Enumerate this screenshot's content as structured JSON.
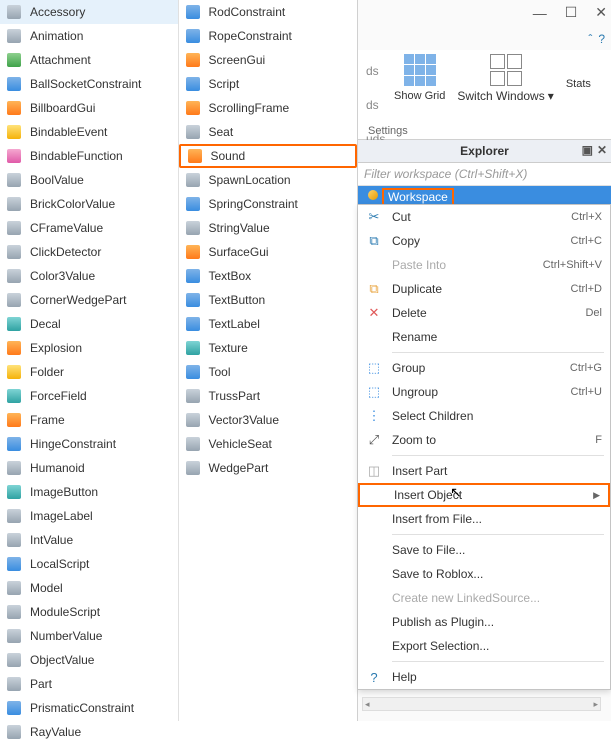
{
  "insert_menu": {
    "col1": [
      {
        "label": "Accessory",
        "icon": "accessory-icon",
        "cls": "ic-gray"
      },
      {
        "label": "Animation",
        "icon": "animation-icon",
        "cls": "ic-gray"
      },
      {
        "label": "Attachment",
        "icon": "attachment-icon",
        "cls": "ic-green"
      },
      {
        "label": "BallSocketConstraint",
        "icon": "ballsocket-icon",
        "cls": "ic-blue"
      },
      {
        "label": "BillboardGui",
        "icon": "billboardgui-icon",
        "cls": "ic-orange"
      },
      {
        "label": "BindableEvent",
        "icon": "bindableevent-icon",
        "cls": "ic-yellow"
      },
      {
        "label": "BindableFunction",
        "icon": "bindablefunction-icon",
        "cls": "ic-pink"
      },
      {
        "label": "BoolValue",
        "icon": "boolvalue-icon",
        "cls": "ic-gray"
      },
      {
        "label": "BrickColorValue",
        "icon": "brickcolorvalue-icon",
        "cls": "ic-gray"
      },
      {
        "label": "CFrameValue",
        "icon": "cframevalue-icon",
        "cls": "ic-gray"
      },
      {
        "label": "ClickDetector",
        "icon": "clickdetector-icon",
        "cls": "ic-gray"
      },
      {
        "label": "Color3Value",
        "icon": "color3value-icon",
        "cls": "ic-gray"
      },
      {
        "label": "CornerWedgePart",
        "icon": "cornerwedge-icon",
        "cls": "ic-gray"
      },
      {
        "label": "Decal",
        "icon": "decal-icon",
        "cls": "ic-teal"
      },
      {
        "label": "Explosion",
        "icon": "explosion-icon",
        "cls": "ic-orange"
      },
      {
        "label": "Folder",
        "icon": "folder-icon",
        "cls": "ic-yellow"
      },
      {
        "label": "ForceField",
        "icon": "forcefield-icon",
        "cls": "ic-teal"
      },
      {
        "label": "Frame",
        "icon": "frame-icon",
        "cls": "ic-orange"
      },
      {
        "label": "HingeConstraint",
        "icon": "hinge-icon",
        "cls": "ic-blue"
      },
      {
        "label": "Humanoid",
        "icon": "humanoid-icon",
        "cls": "ic-gray"
      },
      {
        "label": "ImageButton",
        "icon": "imagebutton-icon",
        "cls": "ic-teal"
      },
      {
        "label": "ImageLabel",
        "icon": "imagelabel-icon",
        "cls": "ic-gray"
      },
      {
        "label": "IntValue",
        "icon": "intvalue-icon",
        "cls": "ic-gray"
      },
      {
        "label": "LocalScript",
        "icon": "localscript-icon",
        "cls": "ic-blue"
      },
      {
        "label": "Model",
        "icon": "model-icon",
        "cls": "ic-gray"
      },
      {
        "label": "ModuleScript",
        "icon": "modulescript-icon",
        "cls": "ic-gray"
      },
      {
        "label": "NumberValue",
        "icon": "numbervalue-icon",
        "cls": "ic-gray"
      },
      {
        "label": "ObjectValue",
        "icon": "objectvalue-icon",
        "cls": "ic-gray"
      },
      {
        "label": "Part",
        "icon": "part-icon",
        "cls": "ic-gray"
      },
      {
        "label": "PrismaticConstraint",
        "icon": "prismatic-icon",
        "cls": "ic-blue"
      },
      {
        "label": "RayValue",
        "icon": "rayvalue-icon",
        "cls": "ic-gray"
      }
    ],
    "col2": [
      {
        "label": "RodConstraint",
        "icon": "rod-icon",
        "cls": "ic-blue"
      },
      {
        "label": "RopeConstraint",
        "icon": "rope-icon",
        "cls": "ic-blue"
      },
      {
        "label": "ScreenGui",
        "icon": "screengui-icon",
        "cls": "ic-orange"
      },
      {
        "label": "Script",
        "icon": "script-icon",
        "cls": "ic-blue"
      },
      {
        "label": "ScrollingFrame",
        "icon": "scrollingframe-icon",
        "cls": "ic-orange"
      },
      {
        "label": "Seat",
        "icon": "seat-icon",
        "cls": "ic-gray"
      },
      {
        "label": "Sound",
        "icon": "sound-icon",
        "cls": "ic-orange",
        "highlight": true
      },
      {
        "label": "SpawnLocation",
        "icon": "spawnlocation-icon",
        "cls": "ic-gray"
      },
      {
        "label": "SpringConstraint",
        "icon": "spring-icon",
        "cls": "ic-blue"
      },
      {
        "label": "StringValue",
        "icon": "stringvalue-icon",
        "cls": "ic-gray"
      },
      {
        "label": "SurfaceGui",
        "icon": "surfacegui-icon",
        "cls": "ic-orange"
      },
      {
        "label": "TextBox",
        "icon": "textbox-icon",
        "cls": "ic-blue"
      },
      {
        "label": "TextButton",
        "icon": "textbutton-icon",
        "cls": "ic-blue"
      },
      {
        "label": "TextLabel",
        "icon": "textlabel-icon",
        "cls": "ic-blue"
      },
      {
        "label": "Texture",
        "icon": "texture-icon",
        "cls": "ic-teal"
      },
      {
        "label": "Tool",
        "icon": "tool-icon",
        "cls": "ic-blue"
      },
      {
        "label": "TrussPart",
        "icon": "trusspart-icon",
        "cls": "ic-gray"
      },
      {
        "label": "Vector3Value",
        "icon": "vector3value-icon",
        "cls": "ic-gray"
      },
      {
        "label": "VehicleSeat",
        "icon": "vehicleseat-icon",
        "cls": "ic-gray"
      },
      {
        "label": "WedgePart",
        "icon": "wedgepart-icon",
        "cls": "ic-gray"
      }
    ]
  },
  "ribbon": {
    "truncated_labels": [
      "ds",
      "ds",
      "uds"
    ],
    "show_grid": "Show\nGrid",
    "switch_windows": "Switch\nWindows",
    "stats": "Stats",
    "settings": "Settings"
  },
  "explorer": {
    "title": "Explorer",
    "filter_placeholder": "Filter workspace (Ctrl+Shift+X)",
    "selected_node": "Workspace"
  },
  "context_menu": [
    {
      "type": "item",
      "label": "Cut",
      "shortcut": "Ctrl+X",
      "icon": "cut-icon",
      "glyph": "✂",
      "color": "#2a7ab0"
    },
    {
      "type": "item",
      "label": "Copy",
      "shortcut": "Ctrl+C",
      "icon": "copy-icon",
      "glyph": "⧉",
      "color": "#2a7ab0"
    },
    {
      "type": "item",
      "label": "Paste Into",
      "shortcut": "Ctrl+Shift+V",
      "icon": "paste-icon",
      "glyph": "",
      "disabled": true
    },
    {
      "type": "item",
      "label": "Duplicate",
      "shortcut": "Ctrl+D",
      "icon": "duplicate-icon",
      "glyph": "⧉",
      "color": "#e8a33d"
    },
    {
      "type": "item",
      "label": "Delete",
      "shortcut": "Del",
      "icon": "delete-icon",
      "glyph": "✕",
      "color": "#e05a5a"
    },
    {
      "type": "item",
      "label": "Rename",
      "icon": "rename-icon",
      "glyph": ""
    },
    {
      "type": "sep"
    },
    {
      "type": "item",
      "label": "Group",
      "shortcut": "Ctrl+G",
      "icon": "group-icon",
      "glyph": "⬚",
      "color": "#3a8de0"
    },
    {
      "type": "item",
      "label": "Ungroup",
      "shortcut": "Ctrl+U",
      "icon": "ungroup-icon",
      "glyph": "⬚",
      "color": "#3a8de0"
    },
    {
      "type": "item",
      "label": "Select Children",
      "icon": "select-children-icon",
      "glyph": "⋮",
      "color": "#3a8de0"
    },
    {
      "type": "item",
      "label": "Zoom to",
      "shortcut": "F",
      "icon": "zoom-to-icon",
      "glyph": "⤢",
      "color": "#555"
    },
    {
      "type": "sep"
    },
    {
      "type": "item",
      "label": "Insert Part",
      "icon": "insert-part-icon",
      "glyph": "◫",
      "color": "#aaa"
    },
    {
      "type": "item",
      "label": "Insert Object",
      "icon": "insert-object-icon",
      "glyph": "",
      "submenu": true,
      "highlight": true
    },
    {
      "type": "item",
      "label": "Insert from File...",
      "icon": "insert-file-icon",
      "glyph": ""
    },
    {
      "type": "sep"
    },
    {
      "type": "item",
      "label": "Save to File...",
      "icon": "save-file-icon",
      "glyph": ""
    },
    {
      "type": "item",
      "label": "Save to Roblox...",
      "icon": "save-roblox-icon",
      "glyph": ""
    },
    {
      "type": "item",
      "label": "Create new LinkedSource...",
      "icon": "linkedsource-icon",
      "glyph": "",
      "disabled": true
    },
    {
      "type": "item",
      "label": "Publish as Plugin...",
      "icon": "publish-plugin-icon",
      "glyph": ""
    },
    {
      "type": "item",
      "label": "Export Selection...",
      "icon": "export-selection-icon",
      "glyph": ""
    },
    {
      "type": "sep"
    },
    {
      "type": "item",
      "label": "Help",
      "icon": "help-icon",
      "glyph": "?",
      "color": "#2a7ab0"
    }
  ]
}
